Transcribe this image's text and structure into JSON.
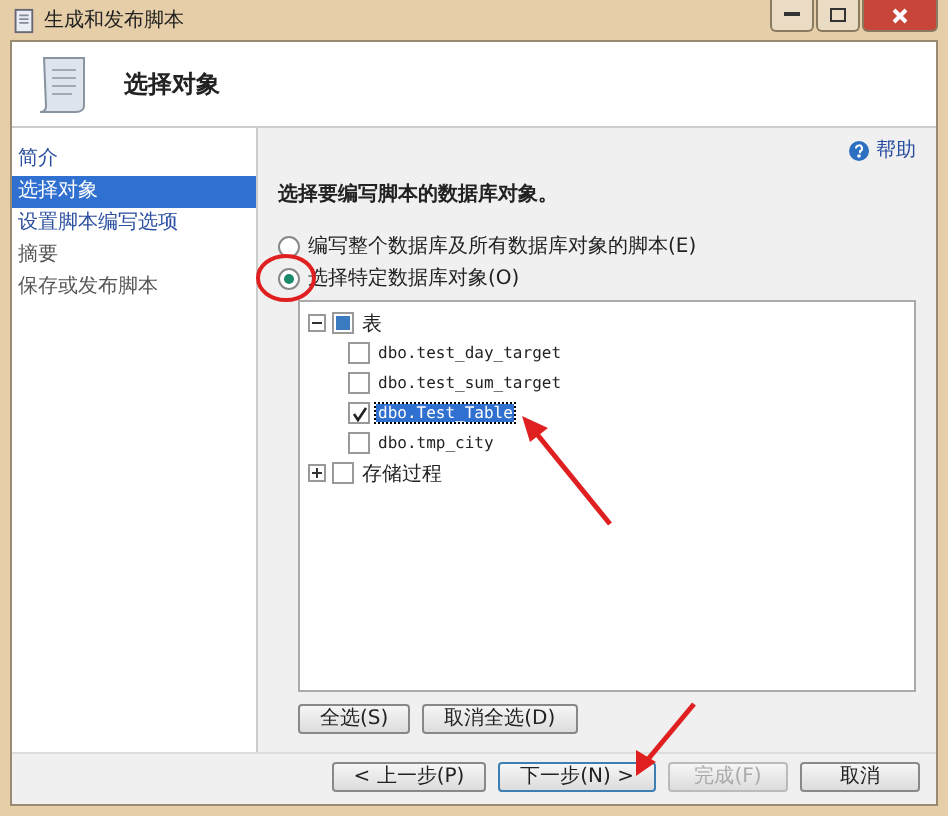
{
  "window": {
    "title": "生成和发布脚本"
  },
  "header": {
    "title": "选择对象"
  },
  "sidebar": {
    "items": [
      {
        "label": "简介",
        "selected": false,
        "disabled": false
      },
      {
        "label": "选择对象",
        "selected": true,
        "disabled": false
      },
      {
        "label": "设置脚本编写选项",
        "selected": false,
        "disabled": false
      },
      {
        "label": "摘要",
        "selected": false,
        "disabled": true
      },
      {
        "label": "保存或发布脚本",
        "selected": false,
        "disabled": true
      }
    ]
  },
  "help": {
    "label": "帮助"
  },
  "prompt": "选择要编写脚本的数据库对象。",
  "options": [
    {
      "label": "编写整个数据库及所有数据库对象的脚本(E)",
      "selected": false
    },
    {
      "label": "选择特定数据库对象(O)",
      "selected": true
    }
  ],
  "tree": [
    {
      "label": "表",
      "expanded": true,
      "partial": true,
      "children": [
        {
          "label": "dbo.test_day_target",
          "checked": false,
          "selected": false
        },
        {
          "label": "dbo.test_sum_target",
          "checked": false,
          "selected": false
        },
        {
          "label": "dbo.Test_Table",
          "checked": true,
          "selected": true
        },
        {
          "label": "dbo.tmp_city",
          "checked": false,
          "selected": false
        }
      ]
    },
    {
      "label": "存储过程",
      "expanded": false,
      "checked": false,
      "partial": false
    }
  ],
  "select_buttons": [
    "全选(S)",
    "取消全选(D)"
  ],
  "nav_buttons": [
    {
      "label": "< 上一步(P)",
      "disabled": false,
      "default": false
    },
    {
      "label": "下一步(N) >",
      "disabled": false,
      "default": true
    },
    {
      "label": "完成(F)",
      "disabled": true,
      "default": false
    },
    {
      "label": "取消",
      "disabled": false,
      "default": false
    }
  ]
}
